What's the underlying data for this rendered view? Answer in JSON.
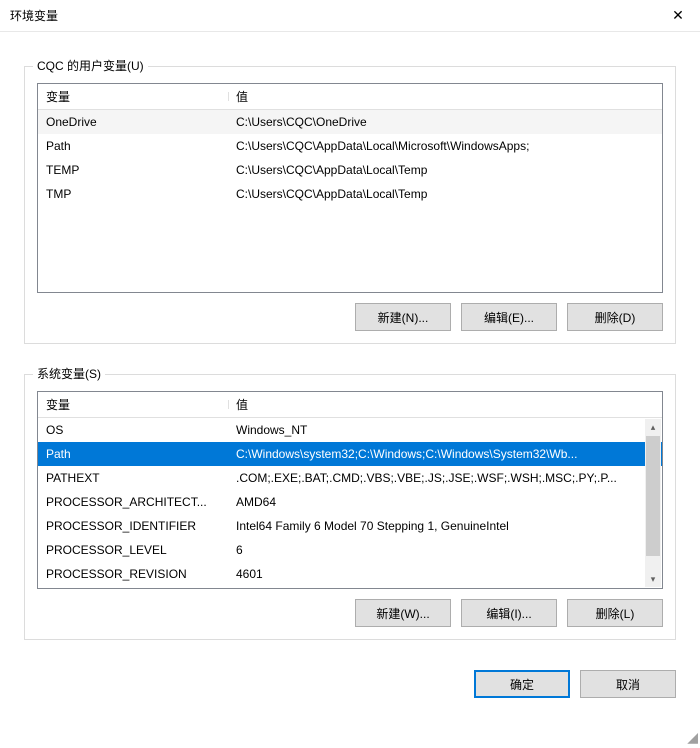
{
  "window": {
    "title": "环境变量",
    "close_glyph": "✕"
  },
  "user_vars": {
    "legend": "CQC 的用户变量(U)",
    "col_name": "变量",
    "col_value": "值",
    "rows": [
      {
        "name": "OneDrive",
        "value": "C:\\Users\\CQC\\OneDrive"
      },
      {
        "name": "Path",
        "value": "C:\\Users\\CQC\\AppData\\Local\\Microsoft\\WindowsApps;"
      },
      {
        "name": "TEMP",
        "value": "C:\\Users\\CQC\\AppData\\Local\\Temp"
      },
      {
        "name": "TMP",
        "value": "C:\\Users\\CQC\\AppData\\Local\\Temp"
      }
    ],
    "btn_new": "新建(N)...",
    "btn_edit": "编辑(E)...",
    "btn_delete": "删除(D)"
  },
  "system_vars": {
    "legend": "系统变量(S)",
    "col_name": "变量",
    "col_value": "值",
    "rows": [
      {
        "name": "OS",
        "value": "Windows_NT"
      },
      {
        "name": "Path",
        "value": "C:\\Windows\\system32;C:\\Windows;C:\\Windows\\System32\\Wb..."
      },
      {
        "name": "PATHEXT",
        "value": ".COM;.EXE;.BAT;.CMD;.VBS;.VBE;.JS;.JSE;.WSF;.WSH;.MSC;.PY;.P..."
      },
      {
        "name": "PROCESSOR_ARCHITECT...",
        "value": "AMD64"
      },
      {
        "name": "PROCESSOR_IDENTIFIER",
        "value": "Intel64 Family 6 Model 70 Stepping 1, GenuineIntel"
      },
      {
        "name": "PROCESSOR_LEVEL",
        "value": "6"
      },
      {
        "name": "PROCESSOR_REVISION",
        "value": "4601"
      }
    ],
    "selected_index": 1,
    "btn_new": "新建(W)...",
    "btn_edit": "编辑(I)...",
    "btn_delete": "删除(L)"
  },
  "dialog": {
    "ok": "确定",
    "cancel": "取消"
  },
  "scrollbar": {
    "up": "▴",
    "down": "▾"
  }
}
